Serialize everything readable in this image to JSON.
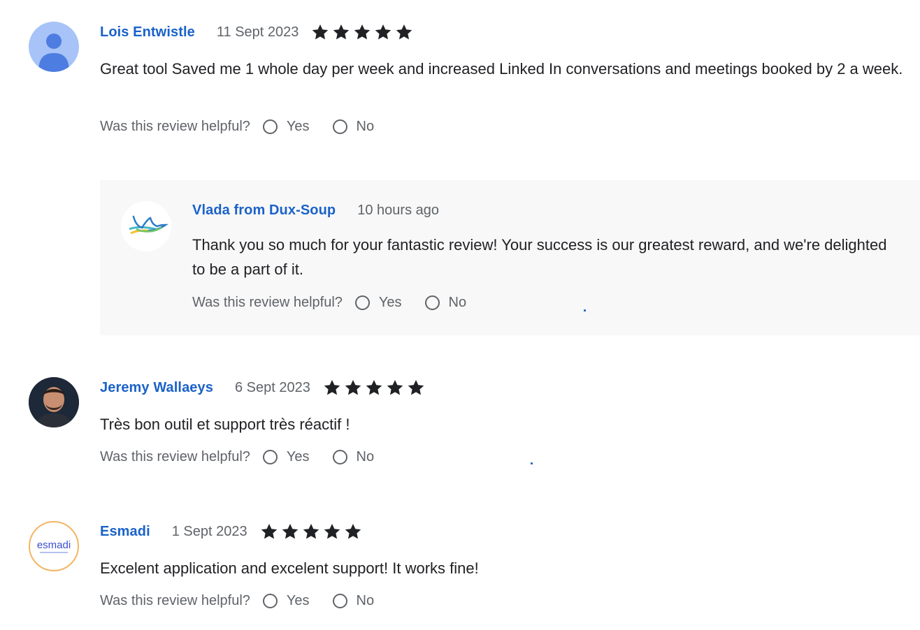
{
  "helpful_prompt": "Was this review helpful?",
  "yes_label": "Yes",
  "no_label": "No",
  "reviews": [
    {
      "name": "Lois Entwistle",
      "date": "11 Sept 2023",
      "rating": 5,
      "text": "Great tool Saved me 1 whole day per week and increased Linked In conversations and meetings booked by 2 a week.",
      "reply": {
        "name": "Vlada from Dux-Soup",
        "time": "10 hours ago",
        "text": "Thank you so much for your fantastic review! Your success is our greatest reward, and we're delighted to be a part of it."
      }
    },
    {
      "name": "Jeremy Wallaeys",
      "date": "6 Sept 2023",
      "rating": 5,
      "text": "Très bon outil et support très réactif !"
    },
    {
      "name": "Esmadi",
      "date": "1 Sept 2023",
      "rating": 5,
      "text": "Excelent application and excelent support! It works fine!",
      "avatar_logo_text": "esmadi"
    }
  ],
  "colors": {
    "name": "#1a62c9",
    "muted": "#5f6368",
    "reply_bg": "#f8f8f8",
    "star": "#202124"
  }
}
